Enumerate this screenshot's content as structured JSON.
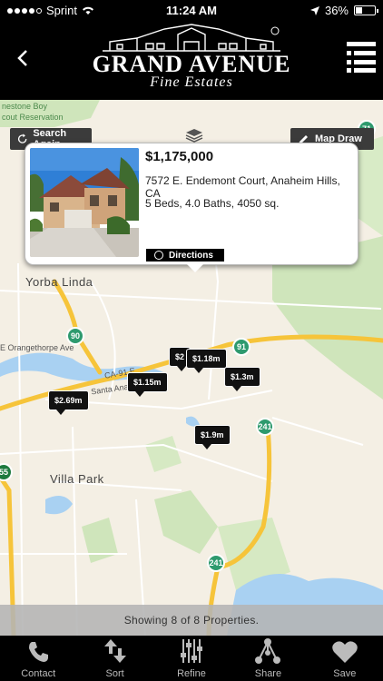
{
  "status_bar": {
    "carrier": "Sprint",
    "time": "11:24 AM",
    "battery": "36%",
    "battery_level": 0.36,
    "signal_bars": 4,
    "icons": [
      "wifi-icon",
      "location-arrow-icon",
      "battery-icon"
    ]
  },
  "header": {
    "brand_line1": "GRAND AVENUE",
    "brand_line2": "Fine Estates",
    "back_icon": "chevron-left-icon",
    "menu_icon": "list-menu-icon"
  },
  "map": {
    "search_again_label": "Search Again",
    "map_draw_label": "Map Draw",
    "layers_icon": "layers-icon",
    "labels": {
      "city_yorba_linda": "Yorba Linda",
      "city_villa_park": "Villa Park",
      "orangethorpe": "E Orangethorpe Ave",
      "ca91": "CA-91 E",
      "santa_ana_canyon": "Santa Ana Cany",
      "limestone": "nestone Boy",
      "reservation": "cout Reservation"
    },
    "shields": [
      "90",
      "91",
      "241",
      "241",
      "55",
      "241",
      "71"
    ],
    "pins": [
      {
        "price": "$2.69m"
      },
      {
        "price": "$1.15m"
      },
      {
        "price": "$2"
      },
      {
        "price": "$1.18m"
      },
      {
        "price": "$1.3m"
      },
      {
        "price": "$1.9m"
      }
    ],
    "colors": {
      "land": "#f4efe4",
      "park": "#cfe5bb",
      "water": "#a9d1f2",
      "highway": "#f6c43a"
    }
  },
  "popup": {
    "price": "$1,175,000",
    "address": "7572 E. Endemont Court, Anaheim Hills, CA",
    "details": "5 Beds, 4.0 Baths, 4050 sq.",
    "directions_label": "Directions"
  },
  "results": {
    "text": "Showing 8 of 8 Properties."
  },
  "tabs": [
    {
      "label": "Contact",
      "icon": "phone-icon"
    },
    {
      "label": "Sort",
      "icon": "sort-arrows-icon"
    },
    {
      "label": "Refine",
      "icon": "sliders-icon"
    },
    {
      "label": "Share",
      "icon": "share-icon"
    },
    {
      "label": "Save",
      "icon": "heart-icon"
    }
  ]
}
